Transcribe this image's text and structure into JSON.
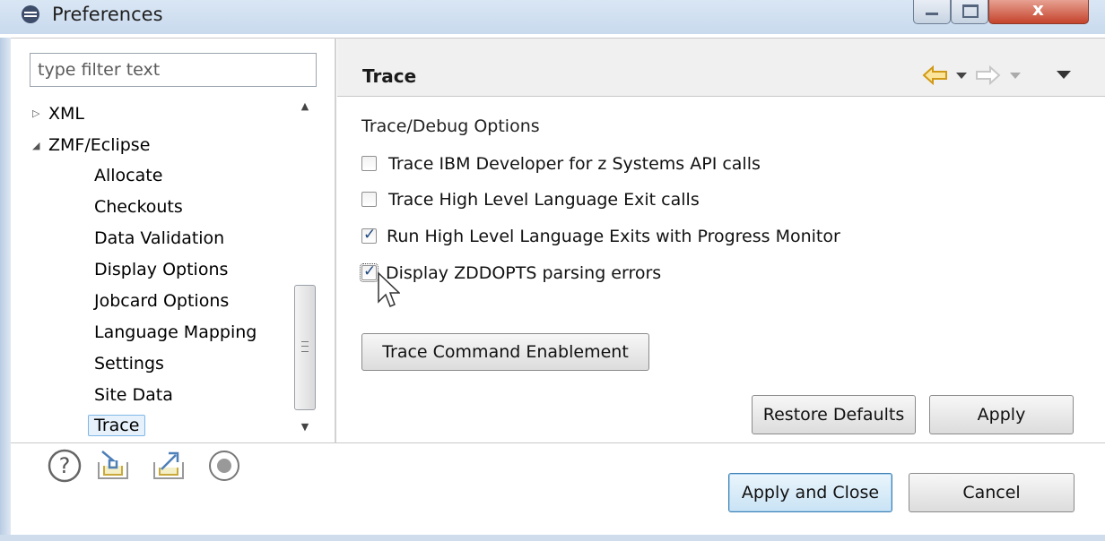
{
  "window": {
    "title": "Preferences"
  },
  "filter": {
    "placeholder": "type filter text",
    "value": ""
  },
  "tree": {
    "items": [
      {
        "label": "XML",
        "expanded": false
      },
      {
        "label": "ZMF/Eclipse",
        "expanded": true
      },
      {
        "label": "Allocate"
      },
      {
        "label": "Checkouts"
      },
      {
        "label": "Data Validation"
      },
      {
        "label": "Display Options"
      },
      {
        "label": "Jobcard Options"
      },
      {
        "label": "Language Mapping"
      },
      {
        "label": "Settings"
      },
      {
        "label": "Site Data"
      },
      {
        "label": "Trace",
        "selected": true
      }
    ]
  },
  "page": {
    "title": "Trace",
    "section_label": "Trace/Debug Options",
    "options": [
      {
        "label": "Trace IBM Developer for z Systems API calls",
        "checked": false
      },
      {
        "label": "Trace High Level Language Exit calls",
        "checked": false
      },
      {
        "label": "Run High Level Language Exits with Progress Monitor",
        "checked": true
      },
      {
        "label": "Display ZDDOPTS parsing errors",
        "checked": true
      }
    ],
    "trace_command_button": "Trace Command Enablement",
    "restore_defaults_button": "Restore Defaults",
    "apply_button": "Apply"
  },
  "footer": {
    "apply_close_button": "Apply and Close",
    "cancel_button": "Cancel"
  },
  "icons": {
    "help": "help-icon",
    "import": "import-icon",
    "export": "export-icon",
    "record": "record-icon",
    "back": "back-arrow-icon",
    "forward": "forward-arrow-icon",
    "view_menu": "view-menu-icon"
  },
  "colors": {
    "nav_back": "#e7b12a",
    "selection_border": "#7fb7e8",
    "default_button_border": "#3c7fb1"
  }
}
